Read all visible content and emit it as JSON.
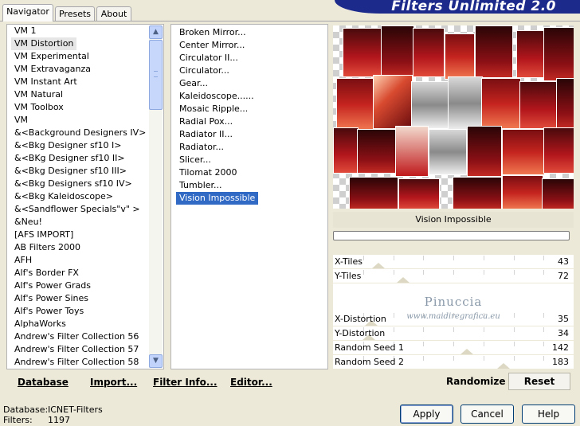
{
  "app_title": "Filters Unlimited 2.0",
  "tabs": [
    {
      "label": "Navigator",
      "active": true
    },
    {
      "label": "Presets",
      "active": false
    },
    {
      "label": "About",
      "active": false
    }
  ],
  "categories": [
    "VM 1",
    "VM Distortion",
    "VM Experimental",
    "VM Extravaganza",
    "VM Instant Art",
    "VM Natural",
    "VM Toolbox",
    "VM",
    "&<Background Designers IV>",
    "&<Bkg Designer sf10 I>",
    "&<BKg Designer sf10 II>",
    "&<Bkg Designer sf10 III>",
    "&<Bkg Designers sf10 IV>",
    "&<Bkg Kaleidoscope>",
    "&<Sandflower Specials\"v\" >",
    "&Neu!",
    "[AFS IMPORT]",
    "AB Filters 2000",
    "AFH",
    "Alf's Border FX",
    "Alf's Power Grads",
    "Alf's Power Sines",
    "Alf's Power Toys",
    "AlphaWorks",
    "Andrew's Filter Collection 56",
    "Andrew's Filter Collection 57",
    "Andrew's Filter Collection 58"
  ],
  "selected_category": "VM Distortion",
  "filters": [
    "Broken Mirror...",
    "Center Mirror...",
    "Circulator II...",
    "Circulator...",
    "Gear...",
    "Kaleidoscope......",
    "Mosaic Ripple...",
    "Radial Pox...",
    "Radiator II...",
    "Radiator...",
    "Slicer...",
    "Tilomat 2000",
    "Tumbler...",
    "Vision Impossible"
  ],
  "selected_filter": "Vision Impossible",
  "left_toolbar": {
    "database": "Database",
    "import": "Import...",
    "filter_info": "Filter Info...",
    "editor": "Editor..."
  },
  "preview": {
    "filter_name": "Vision Impossible"
  },
  "params": [
    {
      "label": "X-Tiles",
      "value": "43",
      "level": 0.17
    },
    {
      "label": "Y-Tiles",
      "value": "72",
      "level": 0.28
    },
    {
      "label": "X-Distortion",
      "value": "35",
      "level": 0.14
    },
    {
      "label": "Y-Distortion",
      "value": "34",
      "level": 0.13
    },
    {
      "label": "Random Seed 1",
      "value": "142",
      "level": 0.56
    },
    {
      "label": "Random Seed 2",
      "value": "183",
      "level": 0.72
    }
  ],
  "watermark": {
    "line1": "Pinuccia",
    "line2": "www.maidiregrafica.eu"
  },
  "right_toolbar": {
    "randomize": "Randomize",
    "reset": "Reset"
  },
  "status": {
    "database_label": "Database:",
    "database_value": "ICNET-Filters",
    "filters_label": "Filters:",
    "filters_value": "1197"
  },
  "buttons": {
    "apply": "Apply",
    "cancel": "Cancel",
    "help": "Help"
  },
  "colors": {
    "selection": "#316ac5",
    "brand": "#1c2a8c",
    "preview_red": "#b3161c"
  }
}
